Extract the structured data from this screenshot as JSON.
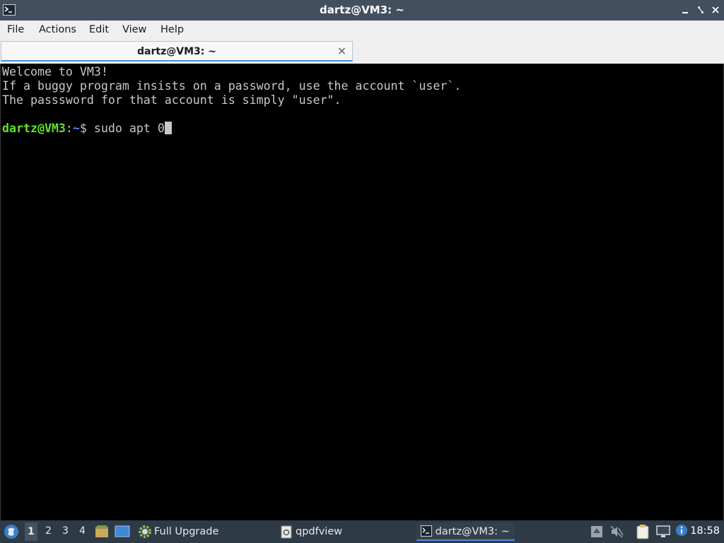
{
  "window": {
    "title": "dartz@VM3: ~",
    "controls": {
      "minimize": "▁",
      "maximize": "◇",
      "close": "✕"
    }
  },
  "menubar": {
    "items": [
      "File",
      "Actions",
      "Edit",
      "View",
      "Help"
    ]
  },
  "tabs": [
    {
      "label": "dartz@VM3: ~",
      "close": "✕",
      "active": true
    }
  ],
  "terminal": {
    "lines": [
      "Welcome to VM3!",
      "If a buggy program insists on a password, use the account `user`.",
      "The passsword for that account is simply \"user\"."
    ],
    "prompt": {
      "user_host": "dartz@VM3",
      "separator": ":",
      "path": "~",
      "symbol": "$ ",
      "command": "sudo apt 0"
    },
    "colors": {
      "text": "#c8c8c8",
      "user_host": "#5fe32a",
      "path": "#5b8ee8",
      "background": "#000000"
    }
  },
  "taskbar": {
    "launcher_icon": "lxqt-menu-icon",
    "workspaces": [
      "1",
      "2",
      "3",
      "4"
    ],
    "active_workspace": "1",
    "quicklaunch": [
      "file-manager-icon",
      "desktop-icon"
    ],
    "tasks": [
      {
        "label": "Full Upgrade",
        "icon": "gear-icon",
        "active": false
      },
      {
        "label": "qpdfview",
        "icon": "document-icon",
        "active": false
      },
      {
        "label": "dartz@VM3: ~",
        "icon": "terminal-icon",
        "active": true
      }
    ],
    "tray_icons": [
      "upload-icon",
      "volume-muted-icon",
      "clipboard-icon",
      "network-icon",
      "info-icon"
    ],
    "clock": "18:58"
  }
}
